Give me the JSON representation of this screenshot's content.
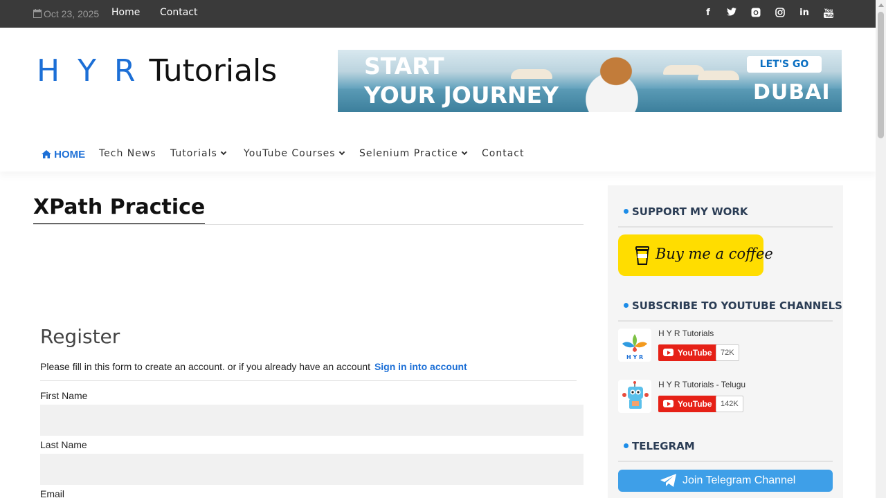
{
  "topbar": {
    "date": "Oct 23, 2025",
    "links": [
      "Home",
      "Contact"
    ],
    "social": [
      "facebook-icon",
      "twitter-icon",
      "github-icon",
      "instagram-icon",
      "linkedin-icon",
      "youtube-icon"
    ]
  },
  "header": {
    "logo_hyr": "H Y R",
    "logo_tutorials": "Tutorials",
    "banner": {
      "line1": "START",
      "line2": "YOUR JOURNEY",
      "cta": "LET'S GO",
      "brand": "DUBAI"
    }
  },
  "nav": {
    "home": "HOME",
    "items": [
      "Tech News",
      "Tutorials",
      "YouTube Courses",
      "Selenium Practice",
      "Contact"
    ]
  },
  "main": {
    "page_title": "XPath Practice",
    "form": {
      "heading": "Register",
      "intro": "Please fill in this form to create an account. or if you already have an account",
      "signin_link": "Sign in into account",
      "fields": [
        {
          "label": "First Name",
          "value": ""
        },
        {
          "label": "Last Name",
          "value": ""
        },
        {
          "label": "Email",
          "value": ""
        }
      ]
    }
  },
  "sidebar": {
    "support_heading": "SUPPORT MY WORK",
    "coffee_label": "Buy me a coffee",
    "youtube_heading": "SUBSCRIBE TO YOUTUBE CHANNELS",
    "channels": [
      {
        "name": "H Y R Tutorials",
        "button": "YouTube",
        "count": "72K",
        "thumb_text": "H Y R"
      },
      {
        "name": "H Y R Tutorials - Telugu",
        "button": "YouTube",
        "count": "142K"
      }
    ],
    "telegram_heading": "TELEGRAM",
    "telegram_button": "Join Telegram Channel"
  },
  "colors": {
    "accent": "#1c6fd6",
    "topbar": "#3a3a3a",
    "coffee": "#ffdd00",
    "youtube": "#e62117",
    "telegram": "#3e9fe8"
  }
}
